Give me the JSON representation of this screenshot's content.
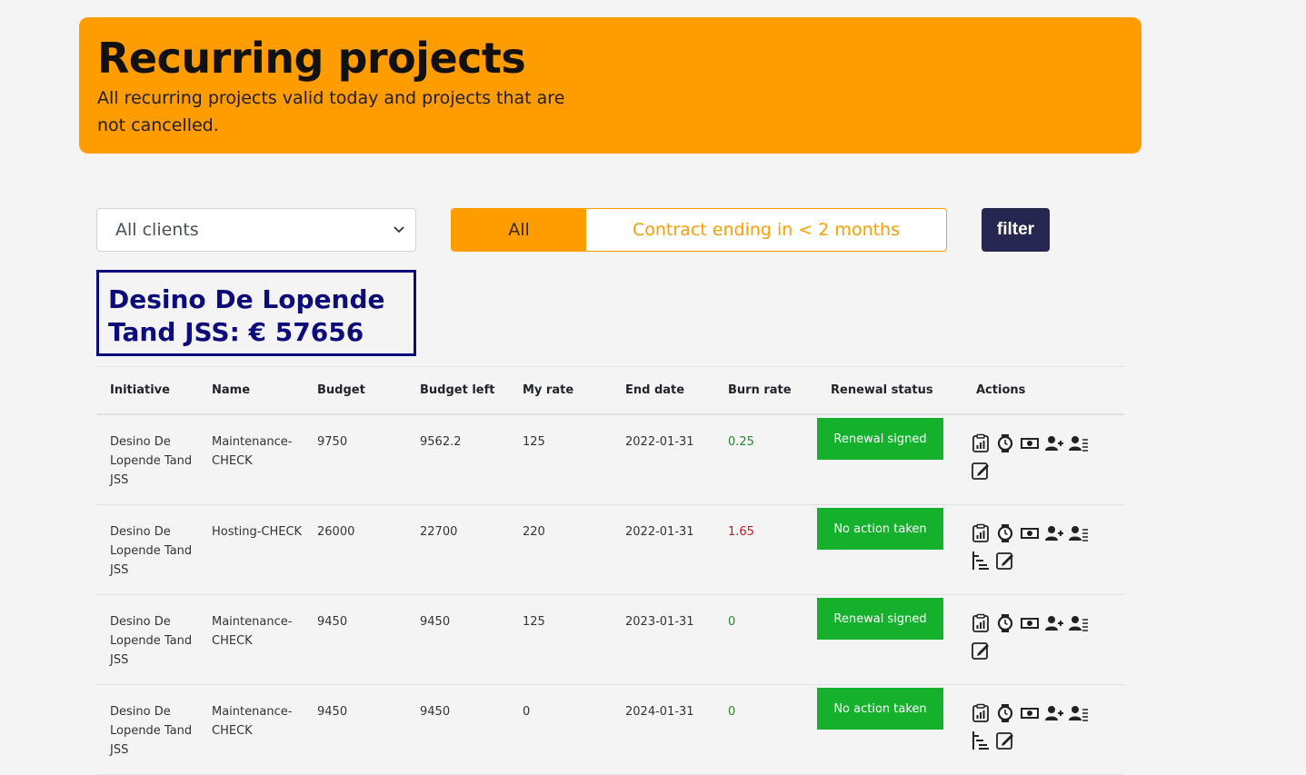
{
  "header": {
    "title": "Recurring projects",
    "subtitle": "All recurring projects valid today and projects that are not cancelled."
  },
  "filters": {
    "client_select": {
      "value": "All clients"
    },
    "segment": {
      "active": "All",
      "other": "Contract ending in < 2 months"
    },
    "filter_button": "filter"
  },
  "client_summary": {
    "line1": "Desino De Lopende",
    "line2": "Tand JSS: € 57656"
  },
  "table": {
    "columns": [
      "Initiative",
      "Name",
      "Budget",
      "Budget left",
      "My rate",
      "End date",
      "Burn rate",
      "Renewal status",
      "Actions"
    ],
    "rows": [
      {
        "initiative": "Desino De Lopende Tand JSS",
        "name": "Maintenance-CHECK",
        "budget": "9750",
        "budget_left": "9562.2",
        "my_rate": "125",
        "end_date": "2022-01-31",
        "burn_rate": "0.25",
        "burn_color": "green",
        "renewal_status": "Renewal signed",
        "actions": [
          "report-icon",
          "watch-icon",
          "money-icon",
          "user-plus-icon",
          "user-list-icon",
          "edit-icon"
        ]
      },
      {
        "initiative": "Desino De Lopende Tand JSS",
        "name": "Hosting-CHECK",
        "budget": "26000",
        "budget_left": "22700",
        "my_rate": "220",
        "end_date": "2022-01-31",
        "burn_rate": "1.65",
        "burn_color": "red",
        "renewal_status": "No action taken",
        "actions": [
          "report-icon",
          "watch-icon",
          "money-icon",
          "user-plus-icon",
          "user-list-icon",
          "tree-list-icon",
          "edit-icon"
        ]
      },
      {
        "initiative": "Desino De Lopende Tand JSS",
        "name": "Maintenance-CHECK",
        "budget": "9450",
        "budget_left": "9450",
        "my_rate": "125",
        "end_date": "2023-01-31",
        "burn_rate": "0",
        "burn_color": "green",
        "renewal_status": "Renewal signed",
        "actions": [
          "report-icon",
          "watch-icon",
          "money-icon",
          "user-plus-icon",
          "user-list-icon",
          "edit-icon"
        ]
      },
      {
        "initiative": "Desino De Lopende Tand JSS",
        "name": "Maintenance-CHECK",
        "budget": "9450",
        "budget_left": "9450",
        "my_rate": "0",
        "end_date": "2024-01-31",
        "burn_rate": "0",
        "burn_color": "green",
        "renewal_status": "No action taken",
        "actions": [
          "report-icon",
          "watch-icon",
          "money-icon",
          "user-plus-icon",
          "user-list-icon",
          "tree-list-icon",
          "edit-icon"
        ]
      }
    ]
  },
  "colors": {
    "accent": "#ff9d00",
    "dark_button": "#252750",
    "badge_green": "#15b12c",
    "client_box": "#0c0c7a"
  }
}
